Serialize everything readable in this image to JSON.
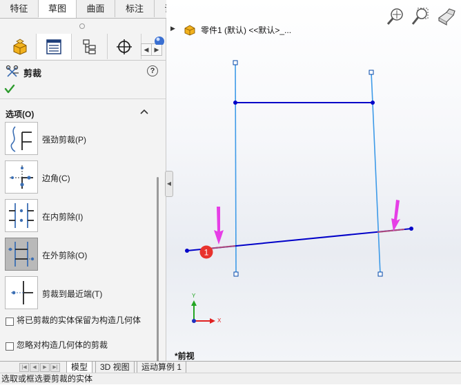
{
  "command_tabs": [
    {
      "label": "特征",
      "active": false
    },
    {
      "label": "草图",
      "active": true
    },
    {
      "label": "曲面",
      "active": false
    },
    {
      "label": "标注",
      "active": false
    },
    {
      "label": "评估",
      "active": false
    }
  ],
  "property_manager": {
    "title": "剪裁",
    "options_group": {
      "header": "选项(O)",
      "items": [
        {
          "label": "强劲剪裁(P)",
          "selected": false,
          "icon": "power-trim-icon"
        },
        {
          "label": "边角(C)",
          "selected": false,
          "icon": "corner-trim-icon"
        },
        {
          "label": "在内剪除(I)",
          "selected": false,
          "icon": "trim-inside-icon"
        },
        {
          "label": "在外剪除(O)",
          "selected": true,
          "icon": "trim-outside-icon"
        },
        {
          "label": "剪裁到最近端(T)",
          "selected": false,
          "icon": "trim-closest-icon"
        }
      ]
    },
    "checkboxes": [
      {
        "label": "将已剪裁的实体保留为构造几何体",
        "checked": false
      },
      {
        "label": "忽略对构造几何体的剪裁",
        "checked": false
      }
    ]
  },
  "graphics": {
    "tree_label": "零件1 (默认) <<默认>_...",
    "view_label": "*前视",
    "callout": "1",
    "triad": {
      "x": "X",
      "y": "Y"
    },
    "colors": {
      "sketch_line": "#0000c8",
      "construction": "#3d9ae8",
      "arrow": "#e63ee6",
      "callout": "#e8322d",
      "selected": "#b04a7a"
    }
  },
  "bottom_tabs": [
    {
      "label": "模型",
      "active": true
    },
    {
      "label": "3D 视图",
      "active": false
    },
    {
      "label": "运动算例 1",
      "active": false
    }
  ],
  "status_text": "选取或框选要剪裁的实体"
}
